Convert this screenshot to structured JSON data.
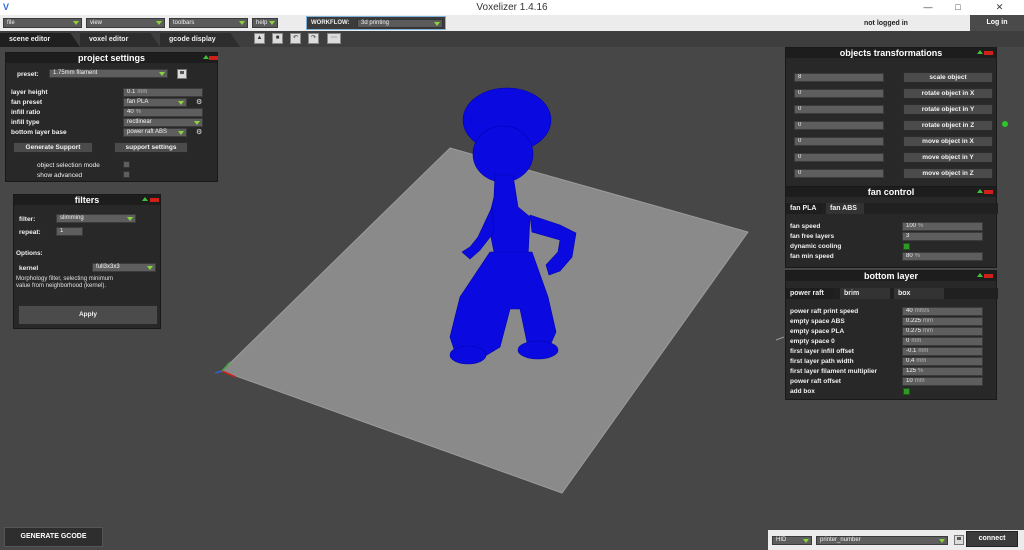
{
  "window": {
    "title": "Voxelizer 1.4.16",
    "icons": {
      "app": "voxelizer-icon",
      "minimize": "minimize-icon",
      "maximize": "maximize-icon",
      "close": "close-icon"
    }
  },
  "menu": {
    "file": "file",
    "view": "view",
    "toolbars": "toolbars",
    "help": "help",
    "workflow_label": "WORKFLOW:",
    "workflow_value": "3d printing",
    "login_status": "not logged in",
    "login_button": "Log in"
  },
  "tabs": [
    {
      "label": "scene editor"
    },
    {
      "label": "voxel editor"
    },
    {
      "label": "gcode display"
    }
  ],
  "toolbar_icons": [
    "open-file-icon",
    "save-file-icon",
    "undo-icon",
    "redo-icon",
    "settings-icon"
  ],
  "project_settings": {
    "title": "project settings",
    "preset_label": "preset:",
    "preset_value": "1.75mm filament",
    "rows": {
      "layer_height": {
        "label": "layer height",
        "value": "0.1",
        "unit": "mm"
      },
      "fan_preset": {
        "label": "fan preset",
        "value": "fan PLA"
      },
      "infill_ratio": {
        "label": "infill ratio",
        "value": "40",
        "unit": "%"
      },
      "infill_type": {
        "label": "infill type",
        "value": "rectlinear"
      },
      "bottom_layer_base": {
        "label": "bottom layer base",
        "value": "power raft ABS"
      }
    },
    "generate_support": "Generate Support",
    "support_settings": "support settings",
    "object_selection_mode": "object selection mode",
    "show_advanced": "show advanced"
  },
  "filters": {
    "title": "filters",
    "filter_label": "filter:",
    "filter_value": "slimming",
    "repeat_label": "repeat:",
    "repeat_value": "1",
    "options_label": "Options:",
    "kernel_label": "kernel",
    "kernel_value": "full3x3x3",
    "description_1": "Morphology filter, selecting minimum",
    "description_2": "value from neighborhood (kernel).",
    "apply": "Apply"
  },
  "objects_transformations": {
    "title": "objects transformations",
    "rows": [
      {
        "value": "8",
        "button": "scale object"
      },
      {
        "value": "0",
        "button": "rotate object in X"
      },
      {
        "value": "0",
        "button": "rotate object in Y"
      },
      {
        "value": "0",
        "button": "rotate object in Z"
      },
      {
        "value": "0",
        "button": "move object in X"
      },
      {
        "value": "0",
        "button": "move object in Y"
      },
      {
        "value": "0",
        "button": "move object in Z"
      }
    ]
  },
  "fan_control": {
    "title": "fan control",
    "tab_pla": "fan PLA",
    "tab_abs": "fan ABS",
    "fan_speed_label": "fan speed",
    "fan_speed_value": "100",
    "fan_speed_unit": "%",
    "fan_free_layers_label": "fan free layers",
    "fan_free_layers_value": "3",
    "dynamic_cooling_label": "dynamic cooling",
    "fan_min_speed_label": "fan min speed",
    "fan_min_speed_value": "80",
    "fan_min_speed_unit": "%"
  },
  "bottom_layer": {
    "title": "bottom layer",
    "tab_power_raft": "power raft",
    "tab_brim": "brim",
    "tab_box": "box",
    "rows": [
      {
        "label": "power raft print speed",
        "value": "40",
        "unit": "mm/s"
      },
      {
        "label": "empty space ABS",
        "value": "0.225",
        "unit": "mm"
      },
      {
        "label": "empty space PLA",
        "value": "0.275",
        "unit": "mm"
      },
      {
        "label": "empty space 0",
        "value": "0",
        "unit": "mm"
      },
      {
        "label": "first layer infill offset",
        "value": "-0.1",
        "unit": "mm"
      },
      {
        "label": "first layer path width",
        "value": "0.4",
        "unit": "mm"
      },
      {
        "label": "first layer filament multiplier",
        "value": "125",
        "unit": "%"
      },
      {
        "label": "power raft offset",
        "value": "10",
        "unit": "mm"
      }
    ],
    "add_box_label": "add box"
  },
  "bottom_bar": {
    "generate_gcode": "GENERATE GCODE",
    "port_value": "HID",
    "printer_value": "printer_number",
    "connect": "connect"
  },
  "colors": {
    "model": "#0a0ae0",
    "bed": "#8a8a8a",
    "viewport": "#474747",
    "panel": "#282828",
    "accent_green": "#2e9a26",
    "accent_red": "#d0201a"
  }
}
